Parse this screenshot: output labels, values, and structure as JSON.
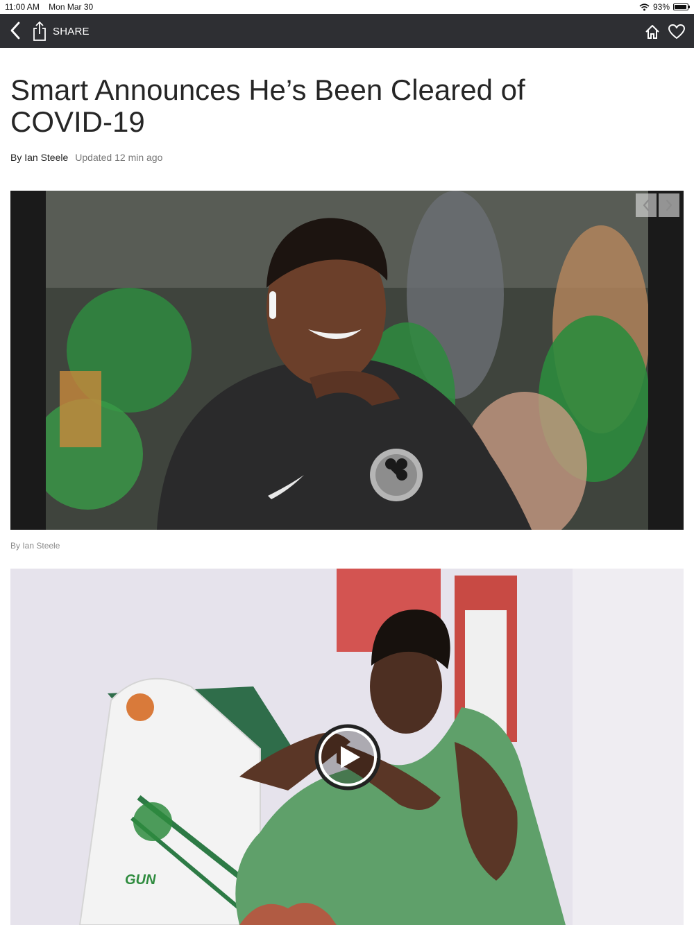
{
  "status_bar": {
    "time": "11:00 AM",
    "date": "Mon Mar 30",
    "battery": "93%",
    "battery_level": 0.93
  },
  "nav": {
    "share_label": "SHARE"
  },
  "article": {
    "headline": "Smart Announces He’s Been Cleared of COVID-19",
    "author": "By Ian Steele",
    "updated": "Updated 12 min ago",
    "photo_caption": "By Ian Steele"
  },
  "icons": {
    "back": "chevron-left-icon",
    "share": "share-icon",
    "home": "home-icon",
    "favorite": "heart-icon",
    "gallery_prev": "chevron-left-icon",
    "gallery_next": "chevron-right-icon",
    "video_play": "play-icon"
  },
  "colors": {
    "nav_background": "#2e2f33",
    "celtics_green": "#2e8b3e"
  }
}
